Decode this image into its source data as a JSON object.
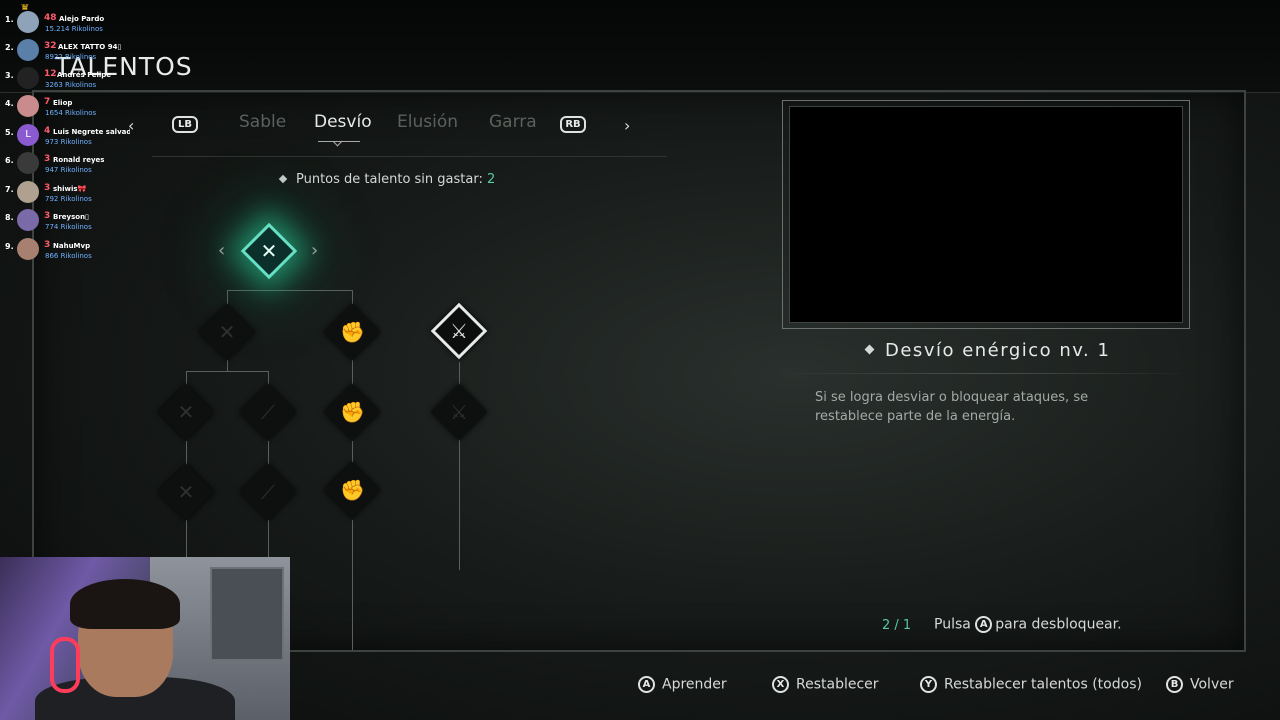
{
  "screen": {
    "title": "TALENTOS"
  },
  "tabs": {
    "prev_arrow": "‹",
    "next_arrow": "›",
    "left_shoulder": "LB",
    "right_shoulder": "RB",
    "items": [
      {
        "label": "Sable",
        "active": false
      },
      {
        "label": "Desvío",
        "active": true
      },
      {
        "label": "Elusión",
        "active": false
      },
      {
        "label": "Garra",
        "active": false
      }
    ]
  },
  "talent_points": {
    "label": "Puntos de talento sin gastar:",
    "value": "2"
  },
  "tree": {
    "accent": "#58c9a4",
    "nodes": [
      {
        "name": "root",
        "state": "selected-glow",
        "icon": "crossed-blades-icon"
      },
      {
        "name": "branch-a",
        "state": "locked",
        "icon": "crossed-blades-icon"
      },
      {
        "name": "branch-b",
        "state": "locked",
        "icon": "fist-icon"
      },
      {
        "name": "branch-c",
        "state": "highlighted",
        "icon": "slash-icon"
      }
    ]
  },
  "detail": {
    "skill_name": "Desvío enérgico nv. 1",
    "description": "Si se logra desviar o bloquear ataques, se restablece parte de la energía.",
    "level": "2 / 1",
    "unlock_prefix": "Pulsa",
    "unlock_button": "A",
    "unlock_suffix": "para desbloquear."
  },
  "hints": [
    {
      "button": "A",
      "label": "Aprender"
    },
    {
      "button": "X",
      "label": "Restablecer"
    },
    {
      "button": "Y",
      "label": "Restablecer talentos (todos)"
    },
    {
      "button": "B",
      "label": "Volver"
    }
  ],
  "leaderboard": [
    {
      "rank": "1.",
      "score": "48",
      "name": "Alejo Pardo",
      "points": "15.214 Rikolinos",
      "avatar_color": "#8fa3b8"
    },
    {
      "rank": "2.",
      "score": "32",
      "name": "ALEX TATTO 94▯",
      "points": "8922 Rikolinos",
      "avatar_color": "#5a7fa8"
    },
    {
      "rank": "3.",
      "score": "12",
      "name": "Andrés Felipe",
      "points": "3263 Rikolinos",
      "avatar_color": "#222222"
    },
    {
      "rank": "4.",
      "score": "7",
      "name": "Eliop",
      "points": "1654 Rikolinos",
      "avatar_color": "#c98b8b"
    },
    {
      "rank": "5.",
      "score": "4",
      "name": "Luis Negrete salvador",
      "points": "973 Rikolinos",
      "avatar_color": "#8a5ad1",
      "initial": "L"
    },
    {
      "rank": "6.",
      "score": "3",
      "name": "Ronald reyes",
      "points": "947 Rikolinos",
      "avatar_color": "#3a3a3a"
    },
    {
      "rank": "7.",
      "score": "3",
      "name": "shiwis🎀",
      "points": "792 Rikolinos",
      "avatar_color": "#b0a090"
    },
    {
      "rank": "8.",
      "score": "3",
      "name": "Breyson▯",
      "points": "774 Rikolinos",
      "avatar_color": "#7a6aa8"
    },
    {
      "rank": "9.",
      "score": "3",
      "name": "NahuMvp",
      "points": "866 Rikolinos",
      "avatar_color": "#a88070"
    }
  ]
}
